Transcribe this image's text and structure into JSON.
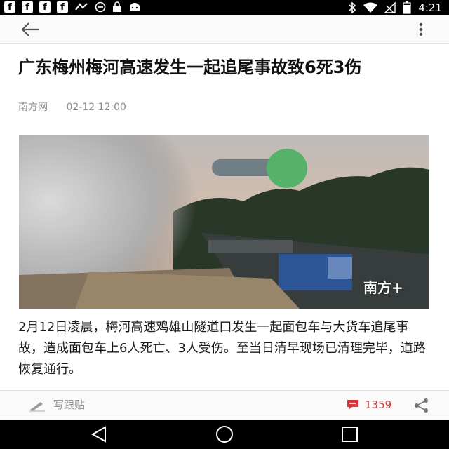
{
  "status_bar": {
    "notification_icons": [
      "f",
      "f",
      "f",
      "f"
    ],
    "time": "4:21",
    "battery_level": 0.8
  },
  "article": {
    "title": "广东梅州梅河高速发生一起追尾事故致6死3伤",
    "source": "南方网",
    "datetime": "02-12 12:00",
    "image_watermark": "南方+",
    "body": "2月12日凌晨，梅河高速鸡雄山隧道口发生一起面包车与大货车追尾事故，造成面包车上6人死亡、3人受伤。至当日清早现场已清理完毕，道路恢复通行。"
  },
  "comment_bar": {
    "compose_label": "写跟贴",
    "comment_count": "1359"
  },
  "colors": {
    "accent_red": "#d9363e",
    "toggle_green": "#56b26a",
    "toggle_track": "#6f7f85"
  },
  "icons": [
    "back-arrow-icon",
    "more-vert-icon",
    "pencil-icon",
    "comment-icon",
    "share-icon",
    "nav-back-icon",
    "nav-home-icon",
    "nav-recents-icon"
  ]
}
